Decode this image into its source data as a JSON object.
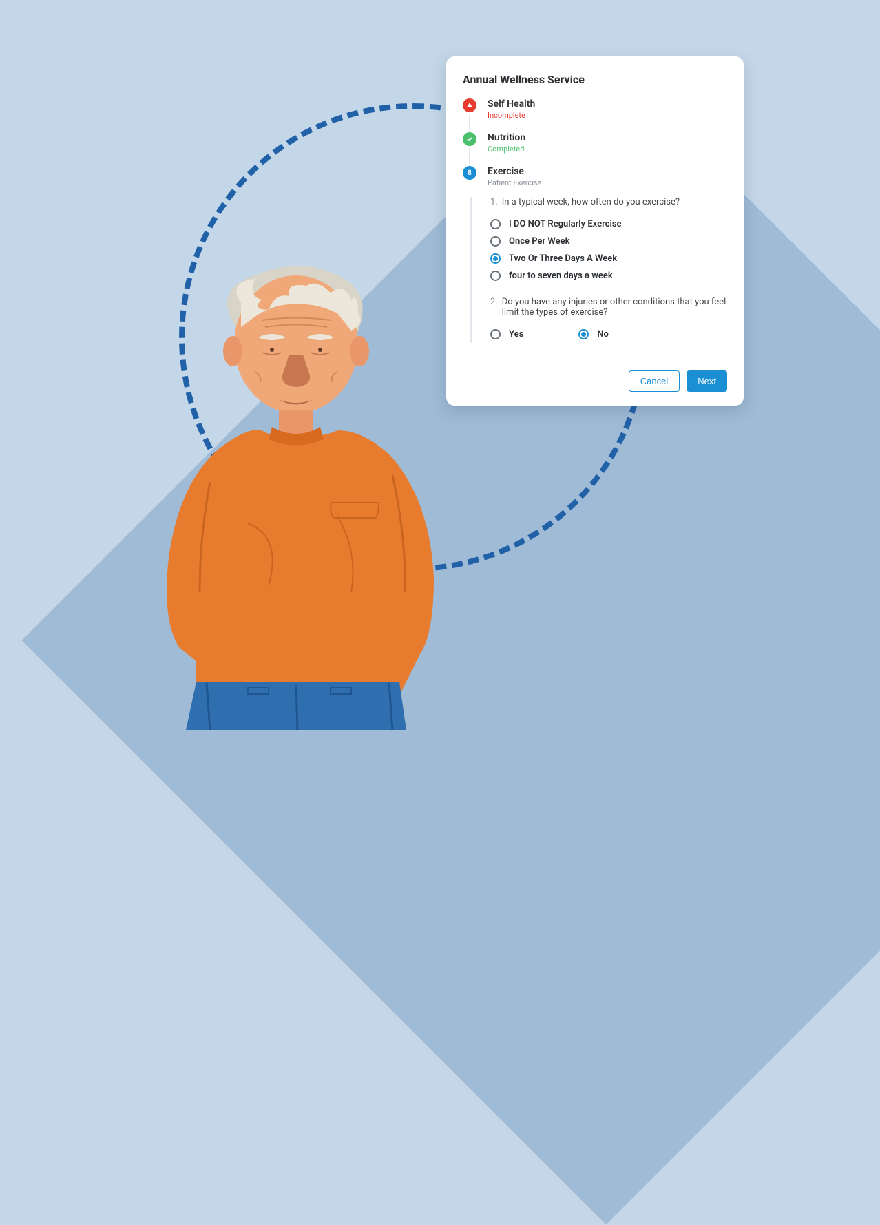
{
  "card": {
    "title": "Annual Wellness Service",
    "steps": [
      {
        "title": "Self Health",
        "subtitle": "Incomplete",
        "status": "incomplete"
      },
      {
        "title": "Nutrition",
        "subtitle": "Completed",
        "status": "complete"
      },
      {
        "title": "Exercise",
        "subtitle": "Patient Exercise",
        "status": "current",
        "number": "8"
      }
    ],
    "questions": [
      {
        "num": "1.",
        "text": "In a typical week, how often do you exercise?",
        "options": [
          {
            "label": "I DO NOT Regularly Exercise",
            "selected": false
          },
          {
            "label": "Once Per Week",
            "selected": false
          },
          {
            "label": "Two Or Three Days A Week",
            "selected": true
          },
          {
            "label": "four to seven days a week",
            "selected": false
          }
        ]
      },
      {
        "num": "2.",
        "text": "Do you have any injuries or other conditions that you feel limit the types of exercise?",
        "options": [
          {
            "label": "Yes",
            "selected": false
          },
          {
            "label": "No",
            "selected": true
          }
        ]
      }
    ],
    "actions": {
      "cancel": "Cancel",
      "next": "Next"
    }
  }
}
